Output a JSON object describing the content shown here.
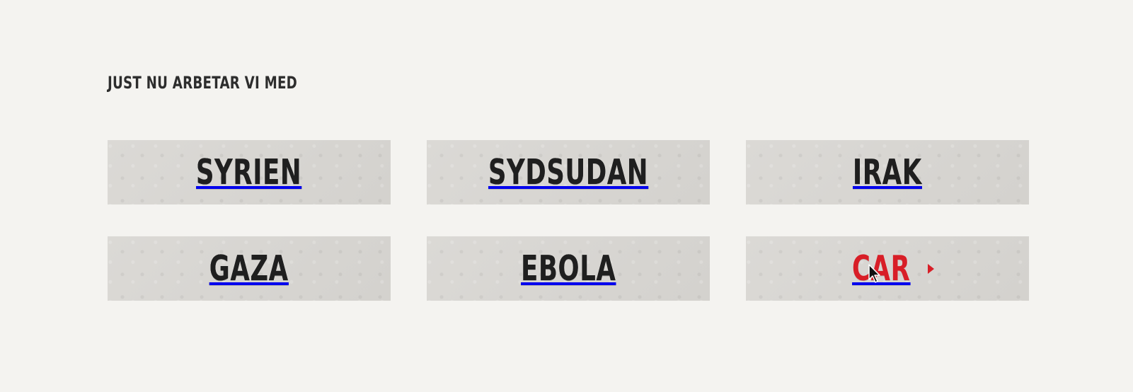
{
  "section": {
    "title": "JUST NU ARBETAR VI MED"
  },
  "tiles": [
    {
      "label": "SYRIEN",
      "state": "normal"
    },
    {
      "label": "SYDSUDAN",
      "state": "normal"
    },
    {
      "label": "IRAK",
      "state": "normal"
    },
    {
      "label": "GAZA",
      "state": "normal"
    },
    {
      "label": "EBOLA",
      "state": "normal"
    },
    {
      "label": "CAR",
      "state": "active"
    }
  ],
  "icons": {
    "active_arrow": "arrow-right-icon",
    "pointer": "cursor-arrow-icon"
  },
  "colors": {
    "page_background": "#f4f3f0",
    "tile_background": "#d8d6d2",
    "text": "#1f1f1f",
    "accent": "#d81e27"
  }
}
